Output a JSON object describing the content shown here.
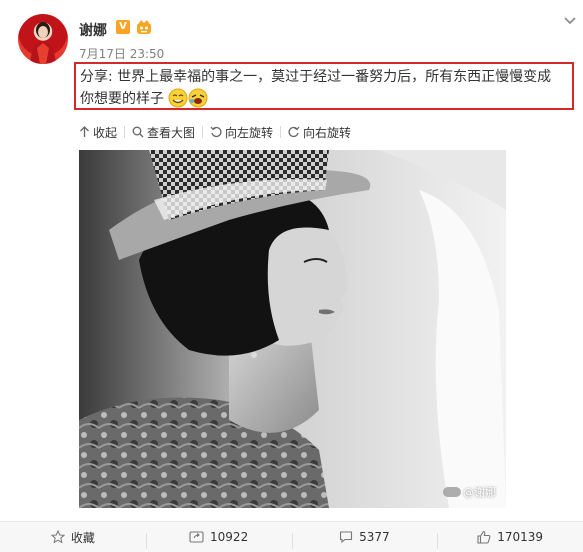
{
  "post": {
    "username": "谢娜",
    "verified_badge": "V",
    "timestamp": "7月17日 23:50",
    "text": "分享: 世界上最幸福的事之一，莫过于经过一番努力后，所有东西正慢慢变成你想要的样子"
  },
  "image_toolbar": {
    "collapse": "收起",
    "view_large": "查看大图",
    "rotate_left": "向左旋转",
    "rotate_right": "向右旋转"
  },
  "photo": {
    "watermark": "@谢娜"
  },
  "actions": {
    "favorite": "收藏",
    "repost_count": "10922",
    "comment_count": "5377",
    "like_count": "170139"
  },
  "colors": {
    "highlight_border": "#d22a2a",
    "verified": "#f7a325",
    "text": "#333333",
    "meta": "#808080"
  }
}
